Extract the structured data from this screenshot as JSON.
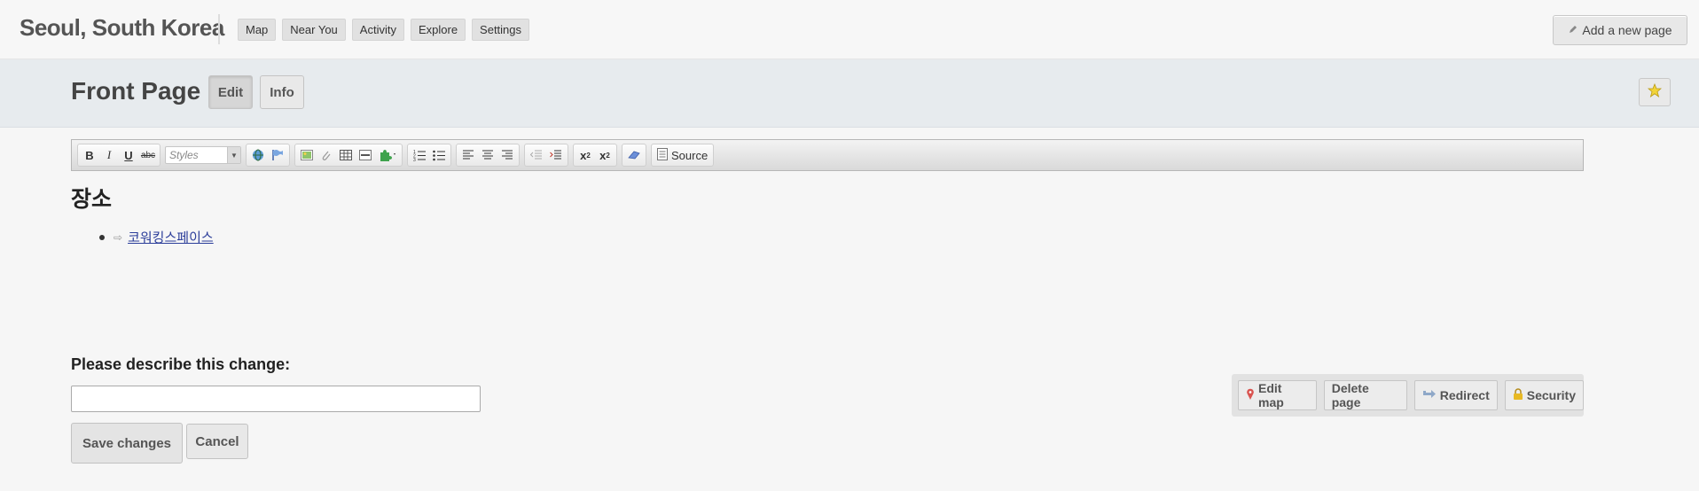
{
  "header": {
    "region_title": "Seoul, South Korea",
    "nav": [
      "Map",
      "Near You",
      "Activity",
      "Explore",
      "Settings"
    ],
    "add_page_label": "Add a new page"
  },
  "page": {
    "title": "Front Page",
    "edit_label": "Edit",
    "info_label": "Info"
  },
  "editor": {
    "styles_placeholder": "Styles",
    "source_label": "Source"
  },
  "content": {
    "heading": "장소",
    "items": [
      {
        "label": "코워킹스페이스"
      }
    ]
  },
  "change_form": {
    "label": "Please describe this change:",
    "value": "",
    "save_label": "Save changes",
    "cancel_label": "Cancel"
  },
  "page_actions": {
    "edit_map_label": "Edit map",
    "delete_label": "Delete page",
    "redirect_label": "Redirect",
    "security_label": "Security"
  },
  "colors": {
    "link": "#2c3e9a",
    "header_band": "#e7ebee",
    "map_pin": "#d9534f",
    "star": "#f2d43a"
  }
}
